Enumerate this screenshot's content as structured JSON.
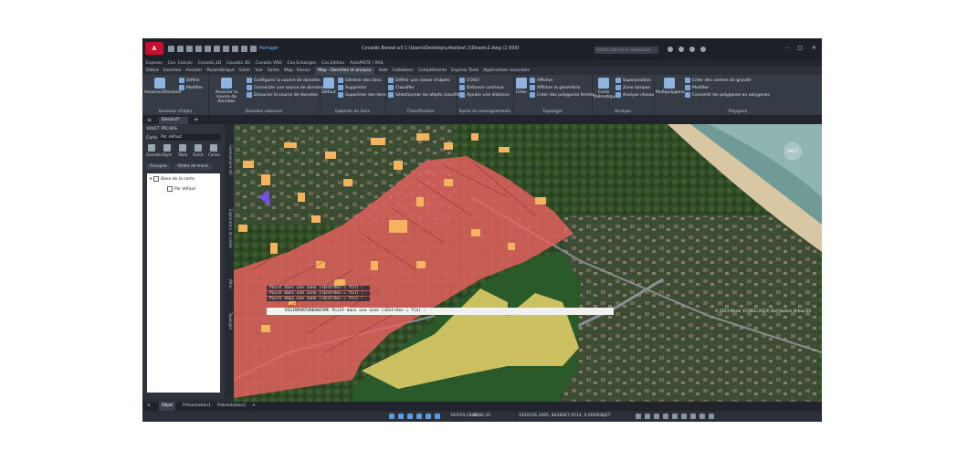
{
  "titlebar": {
    "app_badge": "A",
    "share": "Partager",
    "window_title": "Covadis Boreal a3   C:\\Users\\Desktop\\urba\\test 2\\Dessin2.dwg (1:500)",
    "search_placeholder": "Entrez mot-clé ou expression"
  },
  "menubar": {
    "items": [
      "Express",
      "Cov. Calculs",
      "Covadis 2D",
      "Covadis 3D",
      "Covadis VRD",
      "Cov.Echanges",
      "Cov.Edition",
      "AutoPISTE / RAIL"
    ]
  },
  "tabs": {
    "items": [
      "Début",
      "Insertion",
      "Annoter",
      "Paramétrique",
      "Gérer",
      "Vue",
      "Sortie",
      "Map - Dessin",
      "Map - Données et analyse",
      "Aide",
      "Collaborer",
      "Compléments",
      "Express Tools",
      "Applications associées"
    ],
    "active": "Map - Données et analyse"
  },
  "ribbon": {
    "g1": {
      "label": "Données d'objet",
      "big": "Associer/Dissocier",
      "items": [
        "Définir",
        "Modifier"
      ]
    },
    "g2": {
      "label": "Données externes",
      "big": "Associer la source de données",
      "items": [
        "Configurer la source de données",
        "Connecter une source de données",
        "Dissocier la source de données"
      ]
    },
    "g3": {
      "label": "Gabarits de liens",
      "big": "Défaut",
      "items": [
        "Générer des liens",
        "Supprimer",
        "Supprimer des liens"
      ]
    },
    "g4": {
      "label": "Classification",
      "items": [
        "Définir une classe d'objets",
        "Classifier",
        "Sélectionner les objets classifiés"
      ]
    },
    "g5": {
      "label": "Saisie et renseignements",
      "items": [
        "COGO",
        "Distance continue",
        "Ajouter une distance"
      ]
    },
    "g6": {
      "label": "Topologie",
      "big": "Créer",
      "items": [
        "Afficher",
        "Afficher la géométrie",
        "Créer des polygones fermés"
      ]
    },
    "g7": {
      "label": "Analyse",
      "big": "Carte thématique",
      "items": [
        "Superposition",
        "Zone tampon",
        "Analyse réseau"
      ]
    },
    "g8": {
      "label": "Polygone",
      "big": "Multipolygone",
      "items": [
        "Créer des centres de gravité",
        "Modifier",
        "Convertir les polygones en polygones"
      ]
    }
  },
  "doc": {
    "tab": "Dessin2*"
  },
  "panel": {
    "title": "VOLET TÂCHES",
    "carte_label": "Carte",
    "carte_value": "Par défaut",
    "tools": [
      "Données",
      "Style",
      "Table",
      "Outils",
      "Cartes"
    ],
    "btn_groups": "Groupes",
    "btn_order": "Ordre de tracé",
    "tree_root": "Base de la carte",
    "tree_child": "Par défaut",
    "vtabs": [
      "Gestionnaire aff.",
      "Explorateur de cartes",
      "Atlas",
      "Topologie"
    ]
  },
  "map": {
    "compass": "HAUT",
    "history": [
      "Point dans une zone (<Entrée> = fin) :",
      "Point dans une zone (<Entrée> = fin) :",
      "Point dans une zone (<Entrée> = fin) :"
    ],
    "command": "DIGINPORTURBANISME Point dans une zone (<Entrée> = fin) :",
    "credits": "© 2023 Maxar ©CNES (2023) Distribution Airbus DS"
  },
  "layout": {
    "tabs": [
      "Objet",
      "Présentation1",
      "Présentation2"
    ],
    "active": "Objet"
  },
  "status": {
    "crs": "RGF93.CC49",
    "scale": "1:2280.35",
    "coords": "1450126.2695, 8228467.0514, 0.0000",
    "mode": "OBJET"
  },
  "colors": {
    "accent": "#c8102e",
    "zone_red": "#e8615f",
    "zone_yellow": "#e7d36a",
    "buildings": "#f3b35f"
  }
}
